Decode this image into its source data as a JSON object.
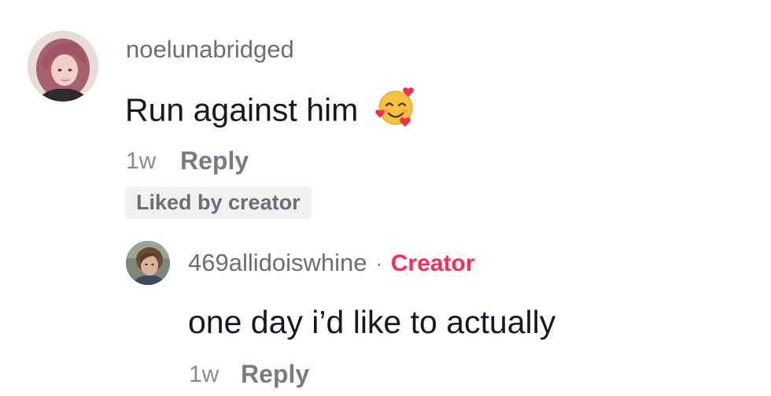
{
  "comment": {
    "username": "noelunabridged",
    "text": "Run against him",
    "emoji_icon": "smiling-face-with-hearts-icon",
    "time": "1w",
    "reply_label": "Reply",
    "badge": "Liked by creator"
  },
  "reply": {
    "username": "469allidoiswhine",
    "separator": "·",
    "role": "Creator",
    "text": "one day i’d like to actually",
    "time": "1w",
    "reply_label": "Reply"
  },
  "colors": {
    "creator_accent": "#fe2c55",
    "username_gray": "#6c6e77",
    "text_dark": "#161823",
    "badge_bg": "#f1f1f2"
  }
}
